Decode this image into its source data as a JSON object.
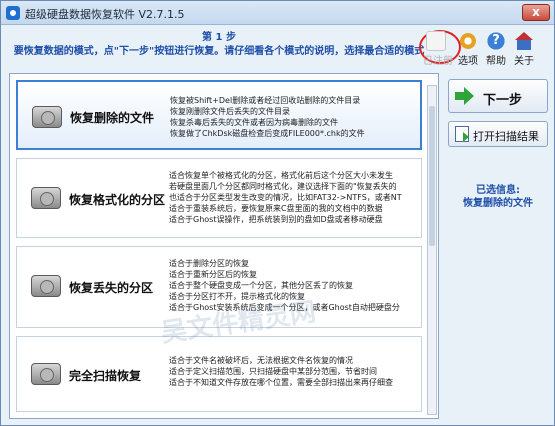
{
  "window": {
    "title": "超级硬盘数据恢复软件 V2.7.1.5",
    "close_label": "x"
  },
  "header": {
    "step_label": "第 1 步",
    "instruction": "要恢复数据的模式，点\"下一步\"按钮进行恢复。请仔细看各个模式的说明，选择最合适的模式"
  },
  "toolbar": {
    "registered_label": "已注册",
    "options_label": "选项",
    "help_label": "帮助",
    "about_label": "关于",
    "help_glyph": "?"
  },
  "modes": [
    {
      "name": "恢复删除的文件",
      "lines": [
        "恢复被Shift+Del删除或者经过回收站删除的文件目录",
        "恢复刚删除文件后丢失的文件目录",
        "恢复杀毒后丢失的文件或者因为病毒删除的文件",
        "恢复做了ChkDsk磁盘检查后变成FILE000*.chk的文件"
      ]
    },
    {
      "name": "恢复格式化的分区",
      "lines": [
        "适合恢复单个被格式化的分区，格式化前后这个分区大小未发生",
        "若硬盘里面几个分区都同时格式化，建议选择下面的\"恢复丢失的",
        "也适合于分区类型发生改变的情况，比如FAT32->NTFS，或者NT",
        "适合于重装系统后，要恢复原来C盘里面的我的文档中的数据",
        "适合于Ghost误操作，把系统装到别的盘如D盘或者移动硬盘"
      ]
    },
    {
      "name": "恢复丢失的分区",
      "lines": [
        "适合于删除分区的恢复",
        "适合于重新分区后的恢复",
        "适合于整个硬盘变成一个分区，其他分区丢了的恢复",
        "适合于分区打不开，提示格式化的恢复",
        "适合于Ghost安装系统后变成一个分区，或者Ghost自动把硬盘分"
      ]
    },
    {
      "name": "完全扫描恢复",
      "lines": [
        "适合于文件名被破坏后，无法根据文件名恢复的情况",
        "适合于定义扫描范围，只扫描硬盘中某部分范围，节省时间",
        "适合于不知道文件存放在哪个位置，需要全部扫描出来再仔细查"
      ]
    }
  ],
  "buttons": {
    "next_label": "下一步",
    "open_scan_label": "打开扫描结果"
  },
  "status": {
    "selected_title": "已选信息:",
    "selected_value": "恢复删除的文件"
  },
  "watermark": "吴文件精灵网"
}
